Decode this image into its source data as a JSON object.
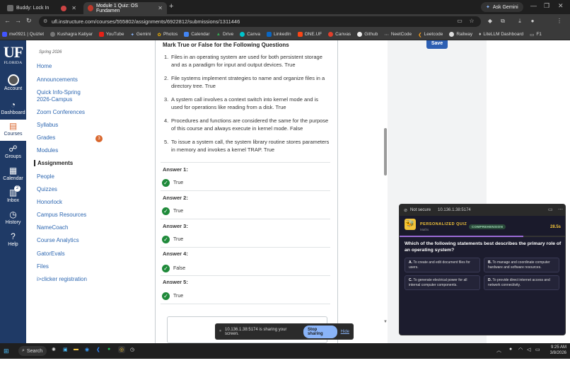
{
  "browser": {
    "tabs": [
      {
        "title": "Buddy: Lock In",
        "active": false
      },
      {
        "title": "Module 1 Quiz: OS Fundamen",
        "active": true
      }
    ],
    "ask_gemini": "Ask Gemini",
    "url": "ufl.instructure.com/courses/555802/assignments/6922812/submissions/1311446",
    "bookmarks": [
      "me0921 | Quizlet",
      "Kushagra Katiyar",
      "YouTube",
      "Gemini",
      "Photos",
      "Calendar",
      "Drive",
      "Canva",
      "LinkedIn",
      "ONE.UF",
      "Canvas",
      "Github",
      "NeetCode",
      "Leetcode",
      "Railway",
      "LiteLLM Dashboard",
      "F1"
    ]
  },
  "global_nav": {
    "logo_big": "UF",
    "logo_small": "FLORIDA",
    "items": [
      {
        "label": "Account",
        "icon": "account-avatar"
      },
      {
        "label": "Dashboard",
        "icon": "dashboard-icon"
      },
      {
        "label": "Courses",
        "icon": "courses-icon"
      },
      {
        "label": "Groups",
        "icon": "groups-icon"
      },
      {
        "label": "Calendar",
        "icon": "calendar-icon"
      },
      {
        "label": "Inbox",
        "icon": "inbox-icon",
        "badge": "2"
      },
      {
        "label": "History",
        "icon": "history-icon"
      },
      {
        "label": "Help",
        "icon": "help-icon"
      }
    ]
  },
  "course_nav": {
    "term": "Spring 2026",
    "items": [
      "Home",
      "Announcements",
      "Quick Info-Spring 2026-Campus",
      "Zoom Conferences",
      "Syllabus",
      "Grades",
      "Modules",
      "Assignments",
      "People",
      "Quizzes",
      "Honorlock",
      "Campus Resources",
      "NameCoach",
      "Course Analytics",
      "GatorEvals",
      "Files",
      "i>clicker registration"
    ],
    "grades_badge": "3",
    "active": "Assignments"
  },
  "submission": {
    "title": "Mark True or False for the Following Questions",
    "statements": [
      "Files in an operating system are used for both persistent storage and as a paradigm for input and output devices. True",
      "File systems implement strategies to name and organize files in a directory tree. True",
      "A system call involves a context switch into kernel mode and is used for operations like reading from a disk. True",
      "Procedures and functions are considered the same for the purpose of this course and always execute in kernel mode. False",
      "To issue a system call, the system library routine stores parameters in memory and invokes a kernel TRAP. True"
    ],
    "answers": [
      {
        "label": "Answer 1:",
        "value": "True"
      },
      {
        "label": "Answer 2:",
        "value": "True"
      },
      {
        "label": "Answer 3:",
        "value": "True"
      },
      {
        "label": "Answer 4:",
        "value": "False"
      },
      {
        "label": "Answer 5:",
        "value": "True"
      }
    ],
    "save_label": "Save"
  },
  "popup": {
    "not_secure": "Not secure",
    "address": "10.136.1.38:5174",
    "quiz_title": "PERSONALIZED QUIZ",
    "quiz_sub": "Maths",
    "tag": "COMPREHENSION",
    "timer": "28.5s",
    "progress": 0.74,
    "question": "Which of the following statements best describes the primary role of an operating system?",
    "options": [
      {
        "letter": "A.",
        "text": "To create and edit document files for users."
      },
      {
        "letter": "B.",
        "text": "To manage and coordinate computer hardware and software resources."
      },
      {
        "letter": "C.",
        "text": "To generate electrical power for all internal computer components."
      },
      {
        "letter": "D.",
        "text": "To provide direct internet access and network connectivity."
      }
    ]
  },
  "share_bar": {
    "message": "10.136.1.38:5174 is sharing your screen.",
    "stop": "Stop sharing",
    "hide": "Hide"
  },
  "taskbar": {
    "search": "Search",
    "time": "9:25 AM",
    "date": "3/8/2026"
  },
  "colors": {
    "canvas_nav": "#1f3a66",
    "link": "#2d67b1",
    "correct": "#1f8a3a",
    "quiz_bg": "#1c1c2e",
    "quiz_accent": "#f3c43a"
  }
}
